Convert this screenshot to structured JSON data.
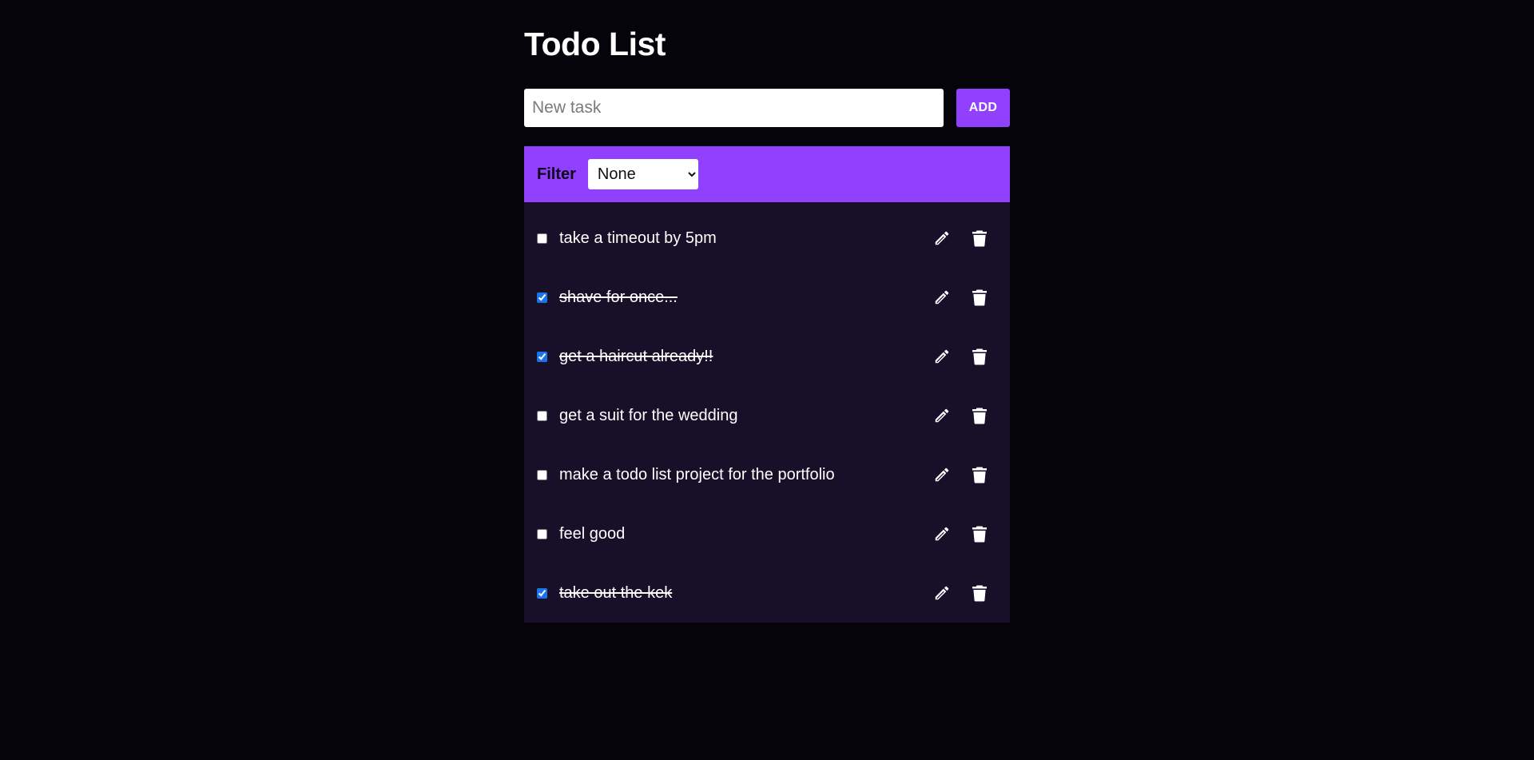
{
  "page": {
    "title": "Todo List"
  },
  "new_task": {
    "placeholder": "New task",
    "value": "",
    "add_label": "ADD"
  },
  "filter": {
    "label": "Filter",
    "selected": "None"
  },
  "todos": [
    {
      "text": "take a timeout by 5pm",
      "completed": false
    },
    {
      "text": "shave for once...",
      "completed": true
    },
    {
      "text": "get a haircut already!!",
      "completed": true
    },
    {
      "text": "get a suit for the wedding",
      "completed": false
    },
    {
      "text": "make a todo list project for the portfolio",
      "completed": false
    },
    {
      "text": "feel good",
      "completed": false
    },
    {
      "text": "take out the kek",
      "completed": true
    }
  ],
  "icons": {
    "edit": "pencil-icon",
    "delete": "trash-icon"
  },
  "colors": {
    "background": "#06040b",
    "accent": "#9141fe",
    "list_background": "#180f28",
    "text": "#ffffff",
    "checkbox_checked": "#1a73e8"
  }
}
